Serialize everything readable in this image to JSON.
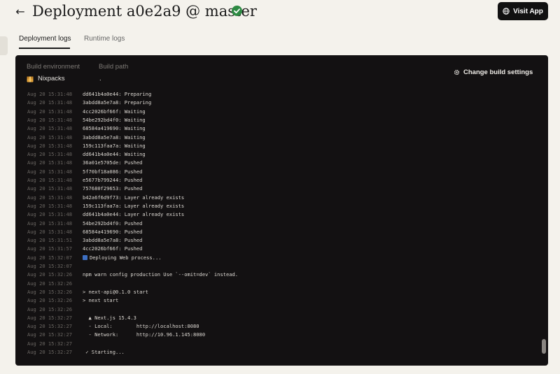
{
  "header": {
    "title": "Deployment a0e2a9 @ master",
    "visit_label": "Visit App",
    "status_color": "#2e8a43"
  },
  "tabs": [
    {
      "label": "Deployment logs",
      "active": true
    },
    {
      "label": "Runtime logs",
      "active": false
    }
  ],
  "build": {
    "env_heading": "Build environment",
    "path_heading": "Build path",
    "env_value": "Nixpacks",
    "path_value": ".",
    "change_label": "Change build settings"
  },
  "logs": [
    {
      "ts": "Aug 20 15:31:48",
      "msg": "dd641b4a0e44: Preparing"
    },
    {
      "ts": "Aug 20 15:31:48",
      "msg": "3abdd8a5e7a8: Preparing"
    },
    {
      "ts": "Aug 20 15:31:48",
      "msg": "4cc2026bf66f: Waiting"
    },
    {
      "ts": "Aug 20 15:31:48",
      "msg": "54be292bd4f0: Waiting"
    },
    {
      "ts": "Aug 20 15:31:48",
      "msg": "68584a419690: Waiting"
    },
    {
      "ts": "Aug 20 15:31:48",
      "msg": "3abdd8a5e7a8: Waiting"
    },
    {
      "ts": "Aug 20 15:31:48",
      "msg": "159c113faa7a: Waiting"
    },
    {
      "ts": "Aug 20 15:31:48",
      "msg": "dd641b4a0e44: Waiting"
    },
    {
      "ts": "Aug 20 15:31:48",
      "msg": "36a01e5705de: Pushed"
    },
    {
      "ts": "Aug 20 15:31:48",
      "msg": "5f70bf18a086: Pushed"
    },
    {
      "ts": "Aug 20 15:31:48",
      "msg": "e5677b799244: Pushed"
    },
    {
      "ts": "Aug 20 15:31:48",
      "msg": "757680f29653: Pushed"
    },
    {
      "ts": "Aug 20 15:31:48",
      "msg": "b42a6f6d9f73: Layer already exists"
    },
    {
      "ts": "Aug 20 15:31:48",
      "msg": "159c113faa7a: Layer already exists"
    },
    {
      "ts": "Aug 20 15:31:48",
      "msg": "dd641b4a0e44: Layer already exists"
    },
    {
      "ts": "Aug 20 15:31:48",
      "msg": "54be292bd4f0: Pushed"
    },
    {
      "ts": "Aug 20 15:31:48",
      "msg": "68584a419690: Pushed"
    },
    {
      "ts": "Aug 20 15:31:51",
      "msg": "3abdd8a5e7a8: Pushed"
    },
    {
      "ts": "Aug 20 15:31:57",
      "msg": "4cc2026bf66f: Pushed"
    },
    {
      "ts": "Aug 20 15:32:07",
      "msg": "Deploying Web process...",
      "icon": true
    },
    {
      "ts": "Aug 20 15:32:07",
      "msg": ""
    },
    {
      "ts": "Aug 20 15:32:26",
      "msg": "npm warn config production Use `--omit=dev` instead."
    },
    {
      "ts": "Aug 20 15:32:26",
      "msg": ""
    },
    {
      "ts": "Aug 20 15:32:26",
      "msg": "> next-api@0.1.0 start"
    },
    {
      "ts": "Aug 20 15:32:26",
      "msg": "> next start"
    },
    {
      "ts": "Aug 20 15:32:26",
      "msg": ""
    },
    {
      "ts": "Aug 20 15:32:27",
      "msg": "  ▲ Next.js 15.4.3"
    },
    {
      "ts": "Aug 20 15:32:27",
      "msg": "  - Local:        http://localhost:8080"
    },
    {
      "ts": "Aug 20 15:32:27",
      "msg": "  - Network:      http://10.96.1.145:8080"
    },
    {
      "ts": "Aug 20 15:32:27",
      "msg": ""
    },
    {
      "ts": "Aug 20 15:32:27",
      "msg": " ✓ Starting..."
    }
  ]
}
